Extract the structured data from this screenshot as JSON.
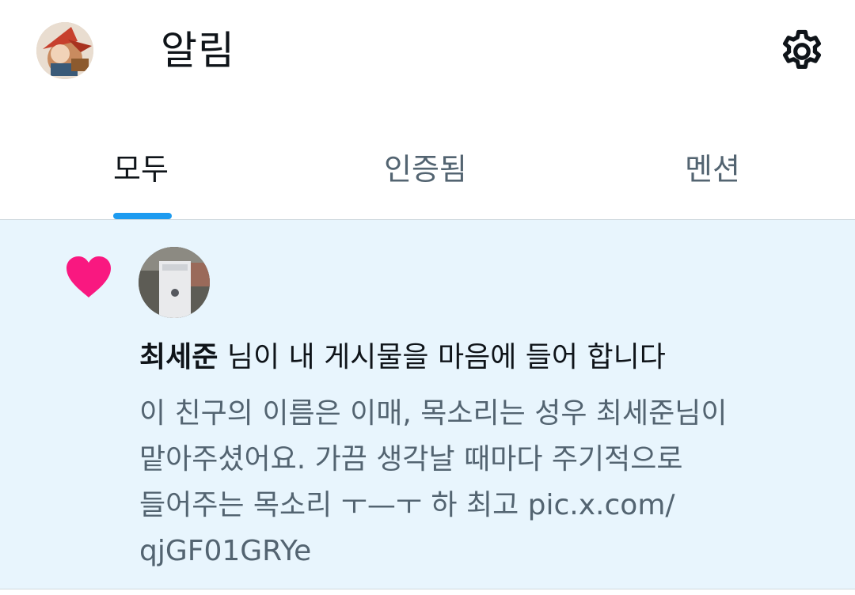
{
  "header": {
    "title": "알림",
    "avatar_icon": "profile-avatar",
    "settings_icon": "gear-icon"
  },
  "tabs": [
    {
      "label": "모두",
      "active": true
    },
    {
      "label": "인증됨",
      "active": false
    },
    {
      "label": "멘션",
      "active": false
    }
  ],
  "notifications": [
    {
      "type_icon": "heart-icon",
      "type_color": "#f91880",
      "actor_name": "최세준",
      "action_text": " 님이 내 게시물을 마음에 들어 합니다",
      "post_text": "이 친구의 이름은 이매, 목소리는 성우 최세준님이\n맡아주셨어요. 가끔 생각날 때마다 주기적으로\n들어주는 목소리 ㅜ—ㅜ 하 최고 pic.x.com/\nqjGF01GRYe"
    }
  ],
  "colors": {
    "accent": "#1d9bf0",
    "like": "#f91880",
    "highlight_background": "#e8f5fd",
    "secondary_text": "#536471",
    "primary_text": "#0f1419"
  }
}
